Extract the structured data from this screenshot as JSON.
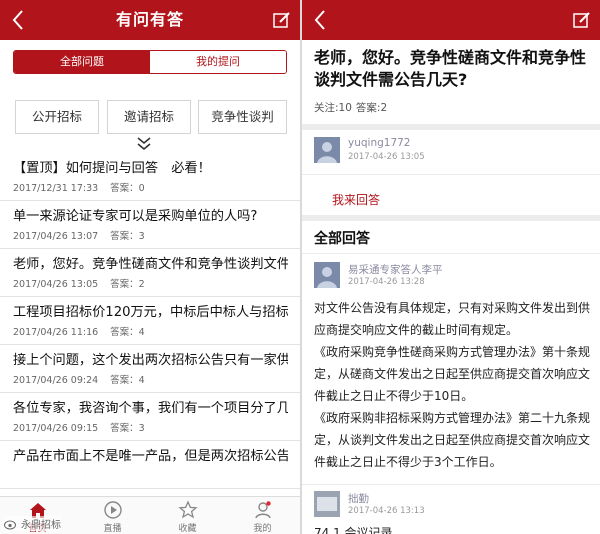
{
  "left": {
    "header": {
      "title": "有问有答"
    },
    "segments": [
      {
        "label": "全部问题",
        "active": true
      },
      {
        "label": "我的提问",
        "active": false
      }
    ],
    "categories": [
      "公开招标",
      "邀请招标",
      "竞争性谈判"
    ],
    "questions": [
      {
        "title": "【置顶】如何提问与回答　必看！",
        "date": "2017/12/31 17:33",
        "answers": "答案：0"
      },
      {
        "title": "单一来源论证专家可以是采购单位的人吗?",
        "date": "2017/04/26 13:07",
        "answers": "答案：3"
      },
      {
        "title": "老师，您好。竞争性磋商文件和竞争性谈判文件",
        "date": "2017/04/26 13:05",
        "answers": "答案：2"
      },
      {
        "title": "工程项目招标价120万元，中标后中标人与招标",
        "date": "2017/04/26 11:16",
        "answers": "答案：4"
      },
      {
        "title": "接上个问题，这个发出两次招标公告只有一家供",
        "date": "2017/04/26 09:24",
        "answers": "答案：4"
      },
      {
        "title": "各位专家，我咨询个事，我们有一个项目分了几",
        "date": "2017/04/26 09:15",
        "answers": "答案：3"
      },
      {
        "title": "产品在市面上不是唯一产品，但是两次招标公告",
        "date": "",
        "answers": ""
      }
    ],
    "tabs": [
      {
        "label": "首页",
        "icon": "home-icon"
      },
      {
        "label": "直播",
        "icon": "play-icon"
      },
      {
        "label": "收藏",
        "icon": "star-icon"
      },
      {
        "label": "我的",
        "icon": "user-icon"
      }
    ],
    "watermark": "永鼎招标"
  },
  "right": {
    "question": {
      "title": "老师，您好。竞争性磋商文件和竞争性谈判文件需公告几天?",
      "follows": "关注:10",
      "answers": "答案:2"
    },
    "asker": {
      "name": "yuqing1772",
      "time": "2017-04-26 13:05"
    },
    "answer_button": "我来回答",
    "section_title": "全部回答",
    "answers": [
      {
        "name": "易采通专家答人李平",
        "time": "2017-04-26 13:28",
        "paragraphs": [
          "对文件公告没有具体规定，只有对采购文件发出到供应商提交响应文件的截止时间有规定。",
          "《政府采购竞争性磋商采购方式管理办法》第十条规定，从磋商文件发出之日起至供应商提交首次响应文件截止之日止不得少于10日。",
          "《政府采购非招标采购方式管理办法》第二十九条规定，从谈判文件发出之日起至供应商提交首次响应文件截止之日止不得少于3个工作日。"
        ]
      },
      {
        "name": "拙勤",
        "time": "2017-04-26 13:13",
        "paragraphs": []
      }
    ],
    "partial_text": "74.1 会议记录"
  },
  "colors": {
    "brand": "#b1151b",
    "divider": "#ececec",
    "meta": "#666666"
  }
}
